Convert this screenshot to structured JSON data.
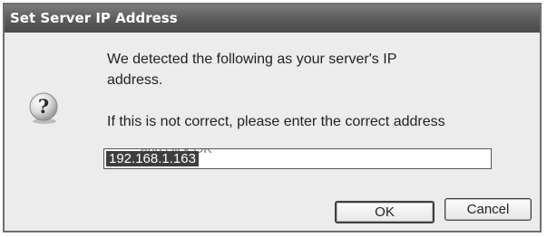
{
  "window": {
    "title": "Set Server IP Address"
  },
  "message": {
    "line1": "We detected the following as your server's IP",
    "line2": "address.",
    "line3": "If this is not correct, please enter the correct address",
    "line4_clipped": "and click OK"
  },
  "icon": {
    "name": "question-icon",
    "glyph": "?"
  },
  "ip_field": {
    "value": "192.168.1.163"
  },
  "buttons": {
    "ok_label": "OK",
    "cancel_label": "Cancel"
  }
}
